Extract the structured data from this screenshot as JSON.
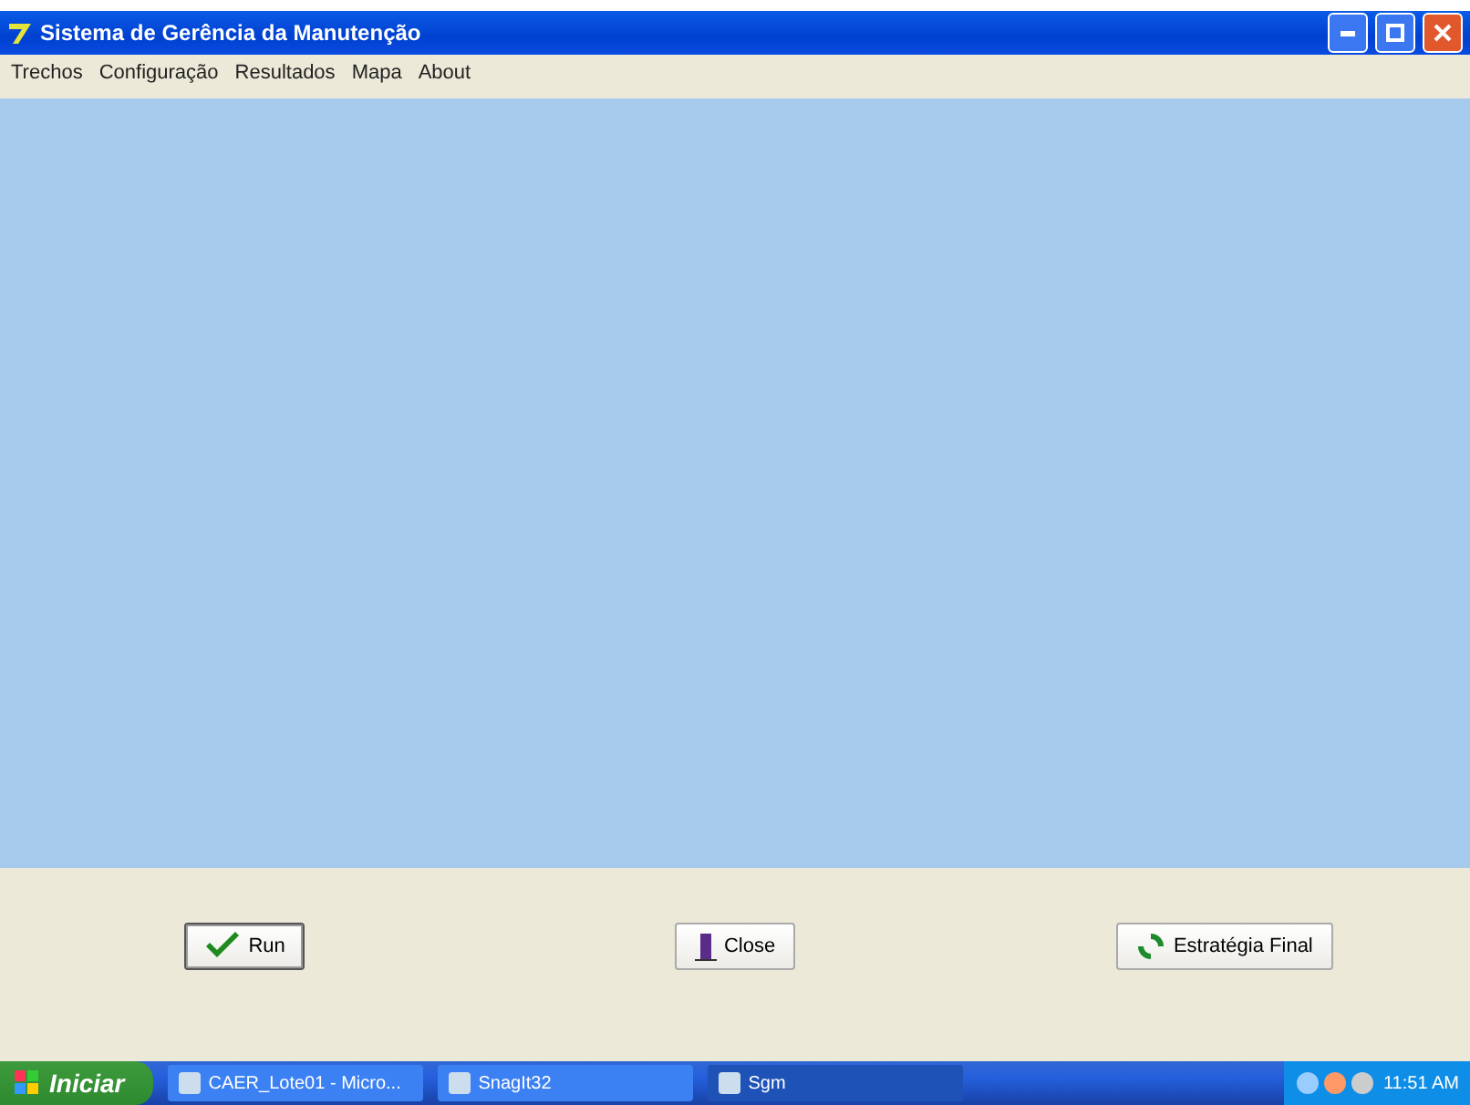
{
  "window": {
    "title": "Sistema de Gerência da Manutenção"
  },
  "menu": [
    "Trechos",
    "Configuração",
    "Resultados",
    "Mapa",
    "About"
  ],
  "buttons": [
    {
      "kind": "check",
      "label": "Run"
    },
    {
      "kind": "door",
      "label": "Close"
    },
    {
      "kind": "refresh",
      "label": "Estratégia Final"
    }
  ],
  "taskbar": {
    "start": "Iniciar",
    "tasks": [
      {
        "label": "CAER_Lote01 - Micro...",
        "selected": false
      },
      {
        "label": "SnagIt32",
        "selected": false
      },
      {
        "label": "Sgm",
        "selected": true
      }
    ],
    "clock": "11:51 AM"
  }
}
